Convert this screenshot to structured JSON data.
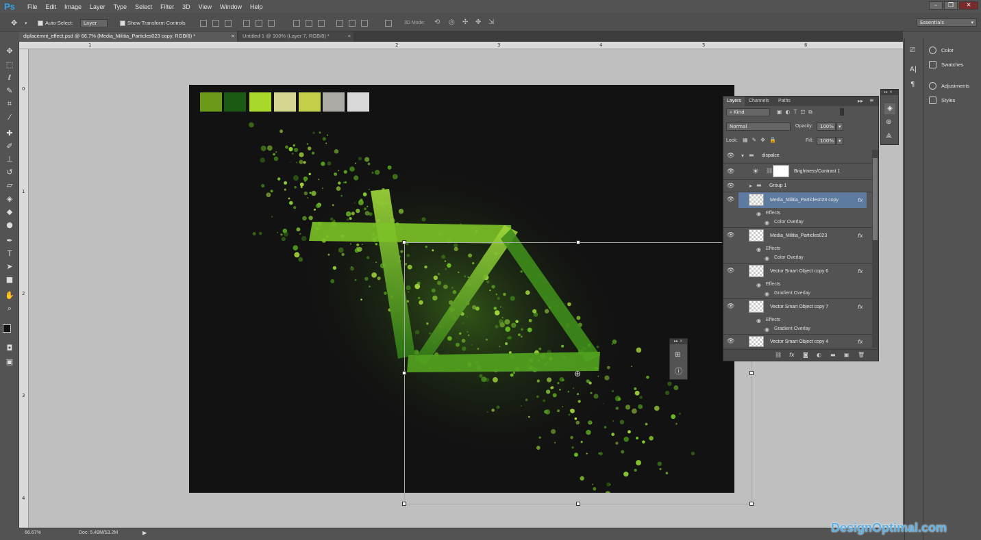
{
  "app": {
    "logo": "Ps"
  },
  "menu": [
    "File",
    "Edit",
    "Image",
    "Layer",
    "Type",
    "Select",
    "Filter",
    "3D",
    "View",
    "Window",
    "Help"
  ],
  "options": {
    "auto_select_label": "Auto-Select:",
    "auto_select_value": "Layer",
    "show_transform_label": "Show Transform Controls",
    "mode_3d_label": "3D Mode:",
    "workspace": "Essentials"
  },
  "tabs": [
    {
      "label": "diplacemnt_effect.psd @ 66.7% (Media_Militia_Particles023 copy, RGB/8) *"
    },
    {
      "label": "Untitled-1 @ 100% (Layer 7, RGB/8) *"
    }
  ],
  "ruler": {
    "top": [
      "1",
      "2",
      "3",
      "4",
      "5",
      "6"
    ],
    "left": [
      "0",
      "1",
      "2",
      "3",
      "4"
    ]
  },
  "swatches": [
    "#6b9a1a",
    "#1a5a12",
    "#a9d82a",
    "#d6d892",
    "#c3cf4a",
    "#acaaa4",
    "#d9d9d9"
  ],
  "right_dock": {
    "items": [
      {
        "label": "Color"
      },
      {
        "label": "Swatches"
      },
      {
        "label": "Adjustments"
      },
      {
        "label": "Styles"
      }
    ]
  },
  "layers_panel": {
    "tabs": [
      "Layers",
      "Channels",
      "Paths"
    ],
    "filter_kind": "Kind",
    "blend_mode": "Normal",
    "opacity_label": "Opacity:",
    "opacity_value": "100%",
    "lock_label": "Lock:",
    "fill_label": "Fill:",
    "fill_value": "100%",
    "layers": [
      {
        "name": "dispalce"
      },
      {
        "name": "Brightness/Contrast 1"
      },
      {
        "name": "Group 1"
      },
      {
        "name": "Media_Militia_Particles023 copy",
        "effects": "Effects",
        "effect": "Color Overlay",
        "fx": "fx"
      },
      {
        "name": "Media_Militia_Particles023",
        "effects": "Effects",
        "effect": "Color Overlay",
        "fx": "fx"
      },
      {
        "name": "Vector Smart Object copy 6",
        "effects": "Effects",
        "effect": "Gradient Overlay",
        "fx": "fx"
      },
      {
        "name": "Vector Smart Object copy 7",
        "effects": "Effects",
        "effect": "Gradient Overlay",
        "fx": "fx"
      },
      {
        "name": "Vector Smart Object copy 4",
        "fx": "fx"
      }
    ]
  },
  "status": {
    "zoom": "66.67%",
    "doc": "Doc: 5.49M/53.2M"
  },
  "watermark": "DesignOptimal.com",
  "colors": {
    "accent_green": "#6bbf24",
    "selected_layer": "#5d7aa0",
    "canvas_bg": "#121212"
  }
}
